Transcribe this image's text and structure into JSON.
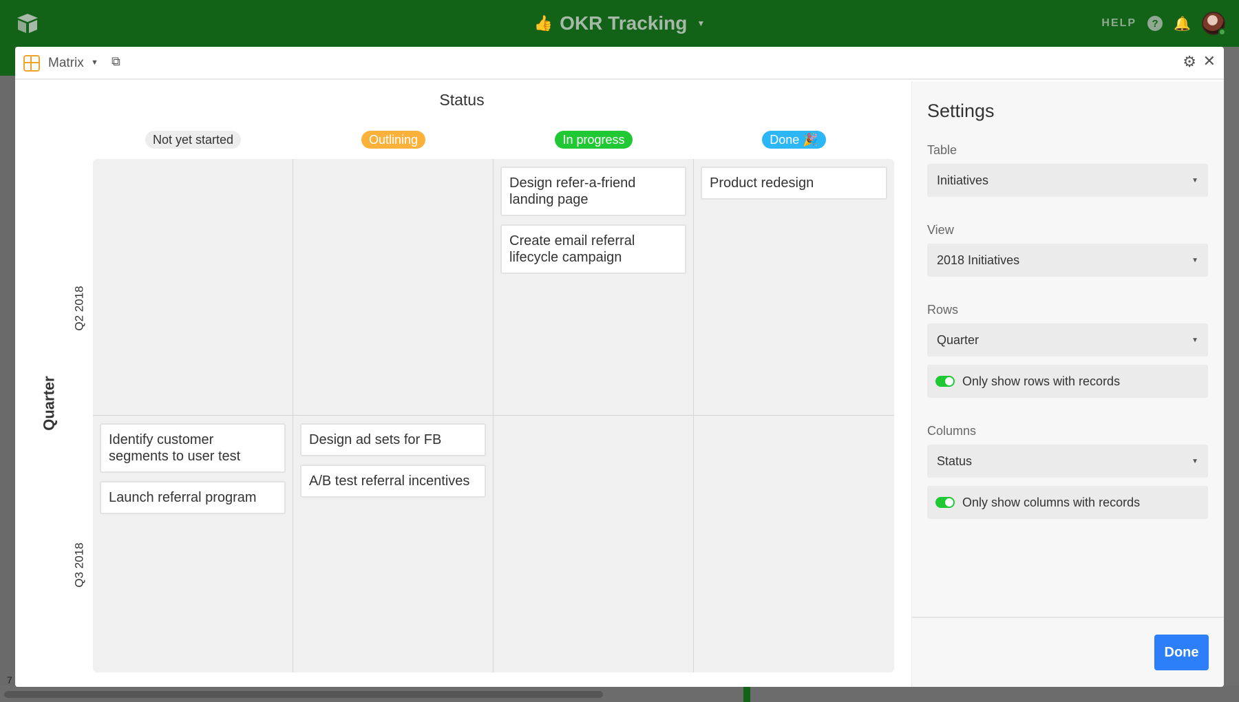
{
  "app": {
    "base_title": "OKR Tracking",
    "help_label": "HELP"
  },
  "block": {
    "name": "Matrix"
  },
  "matrix": {
    "column_field": "Status",
    "row_field": "Quarter",
    "columns": [
      {
        "label": "Not yet started",
        "color": "#ededed"
      },
      {
        "label": "Outlining",
        "color": "#fcb13a"
      },
      {
        "label": "In progress",
        "color": "#20c933"
      },
      {
        "label": "Done 🎉",
        "color": "#2db6f5"
      }
    ],
    "rows": [
      {
        "label": "Q2 2018",
        "cells": [
          [],
          [],
          [
            "Design refer-a-friend landing page",
            "Create email referral lifecycle campaign"
          ],
          [
            "Product redesign"
          ]
        ]
      },
      {
        "label": "Q3 2018",
        "cells": [
          [
            "Identify customer segments to user test",
            "Launch referral program"
          ],
          [
            "Design ad sets for FB",
            "A/B test referral incentives"
          ],
          [],
          []
        ]
      }
    ]
  },
  "settings": {
    "title": "Settings",
    "table_label": "Table",
    "table_value": "Initiatives",
    "view_label": "View",
    "view_value": "2018 Initiatives",
    "rows_label": "Rows",
    "rows_value": "Quarter",
    "rows_toggle_label": "Only show rows with records",
    "columns_label": "Columns",
    "columns_value": "Status",
    "columns_toggle_label": "Only show columns with records",
    "done_label": "Done"
  },
  "background": {
    "row_number": "7"
  },
  "colors": {
    "topbar": "#126218",
    "accent_blue": "#2d7ff9",
    "toggle_on": "#20c933"
  }
}
